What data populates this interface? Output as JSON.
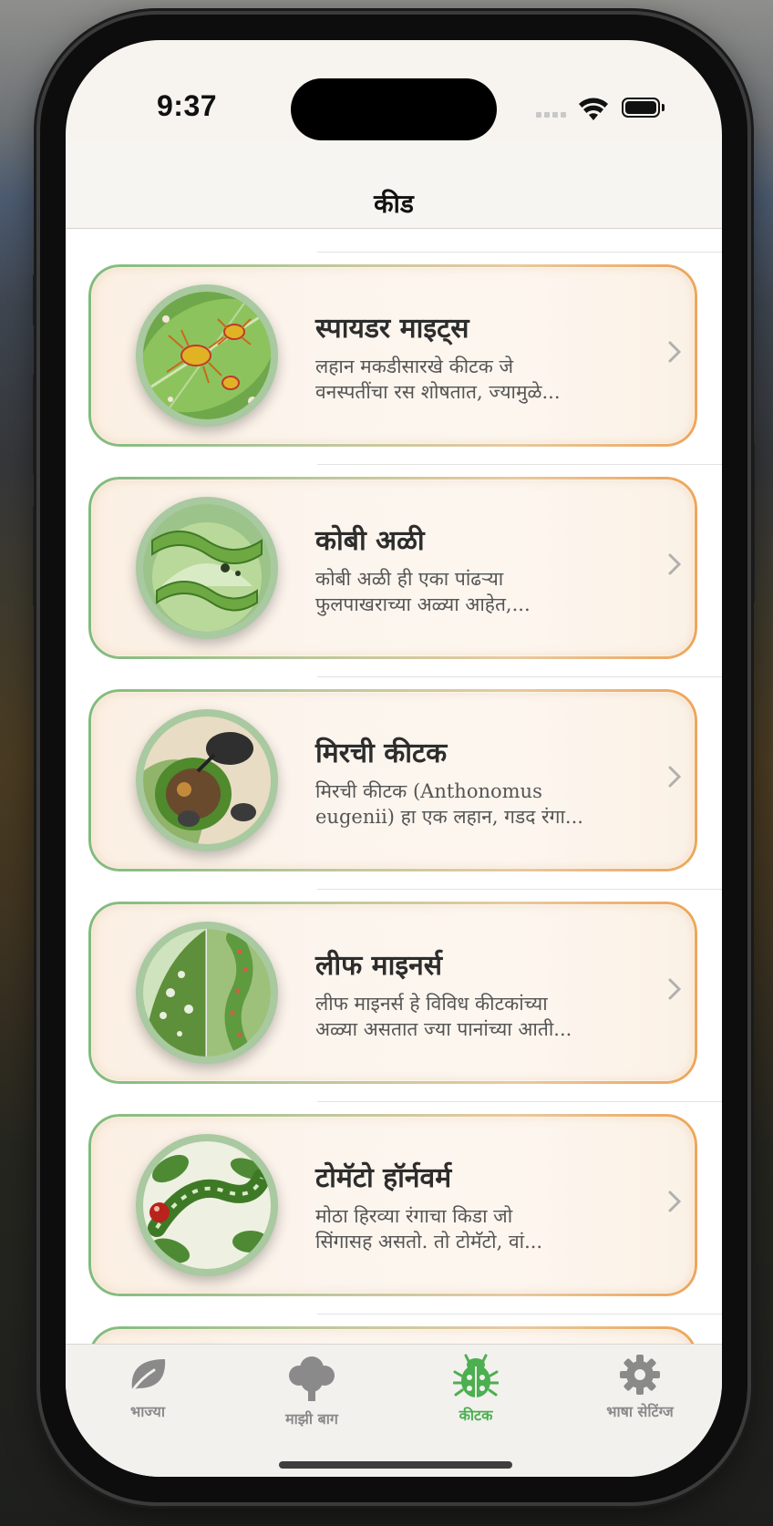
{
  "status_bar": {
    "time": "9:37"
  },
  "nav": {
    "title": "कीड"
  },
  "pests": [
    {
      "title": "स्पायडर माइट्स",
      "desc_1": "लहान मकडीसारखे कीटक जे",
      "desc_2": "वनस्पतींचा रस शोषतात, ज्यामुळे..."
    },
    {
      "title": "कोबी अळी",
      "desc_1": "कोबी अळी ही एका पांढऱ्या",
      "desc_2": "फुलपाखराच्या अळ्या आहेत,..."
    },
    {
      "title": "मिरची कीटक",
      "desc_1": "मिरची कीटक (Anthonomus",
      "desc_2": "eugenii) हा एक लहान, गडद रंगा..."
    },
    {
      "title": "लीफ माइनर्स",
      "desc_1": "लीफ माइनर्स हे विविध कीटकांच्या",
      "desc_2": "अळ्या असतात ज्या पानांच्या आती..."
    },
    {
      "title": "टोमॅटो हॉर्नवर्म",
      "desc_1": "मोठा हिरव्या रंगाचा किडा जो",
      "desc_2": "सिंगासह असतो. तो टोमॅटो, वां..."
    }
  ],
  "tabs": [
    {
      "label": "भाज्या",
      "icon": "leaf-icon"
    },
    {
      "label": "माझी बाग",
      "icon": "tree-icon"
    },
    {
      "label": "कीटक",
      "icon": "ladybug-icon"
    },
    {
      "label": "भाषा सेटिंग्ज",
      "icon": "gear-icon"
    }
  ],
  "colors": {
    "accent": "#4caf50",
    "inactive": "#8a8a8a",
    "card_border_start": "#7fbb7d",
    "card_border_end": "#eea55a"
  }
}
